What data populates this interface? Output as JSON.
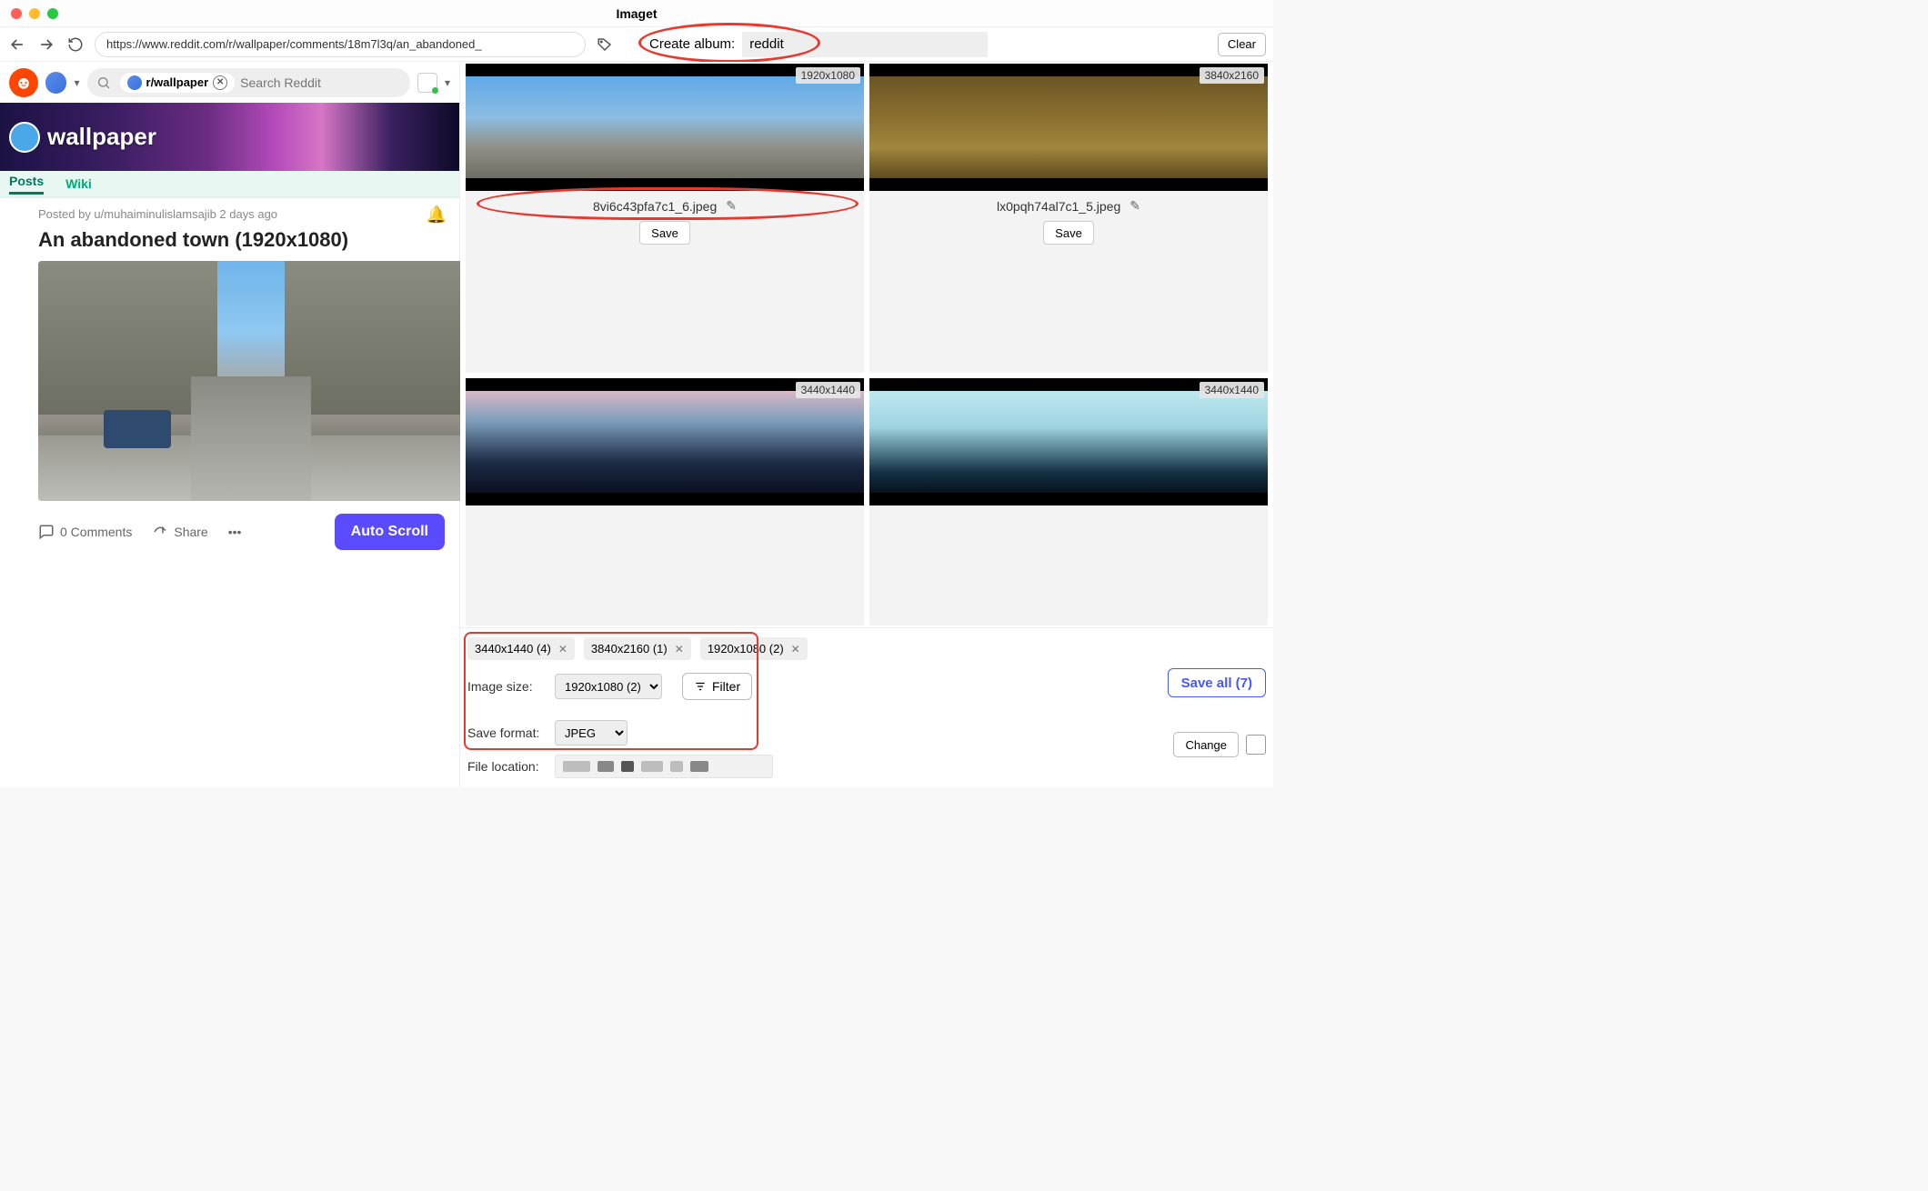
{
  "window": {
    "title": "Imaget"
  },
  "nav": {
    "url": "https://www.reddit.com/r/wallpaper/comments/18m7l3q/an_abandoned_"
  },
  "album": {
    "label": "Create album:",
    "value": "reddit",
    "clear": "Clear"
  },
  "reddit": {
    "subreddit": "r/wallpaper",
    "search_placeholder": "Search Reddit",
    "banner_title": "wallpaper",
    "tabs": {
      "posts": "Posts",
      "wiki": "Wiki"
    },
    "post": {
      "meta": "Posted by u/muhaiminulislamsajib 2 days ago",
      "title": "An abandoned town (1920x1080)",
      "comments": "0 Comments",
      "share": "Share",
      "autoscroll": "Auto Scroll"
    }
  },
  "gallery": {
    "items": [
      {
        "res": "1920x1080",
        "file": "8vi6c43pfa7c1_6.jpeg",
        "save": "Save"
      },
      {
        "res": "3840x2160",
        "file": "lx0pqh74al7c1_5.jpeg",
        "save": "Save"
      },
      {
        "res": "3440x1440"
      },
      {
        "res": "3440x1440"
      }
    ]
  },
  "filters": {
    "chips": [
      "3440x1440 (4)",
      "3840x2160 (1)",
      "1920x1080 (2)"
    ],
    "image_size_label": "Image size:",
    "image_size_value": "1920x1080 (2)",
    "filter_btn": "Filter",
    "save_all": "Save all (7)",
    "save_format_label": "Save format:",
    "save_format_value": "JPEG",
    "file_location_label": "File location:",
    "change": "Change"
  }
}
